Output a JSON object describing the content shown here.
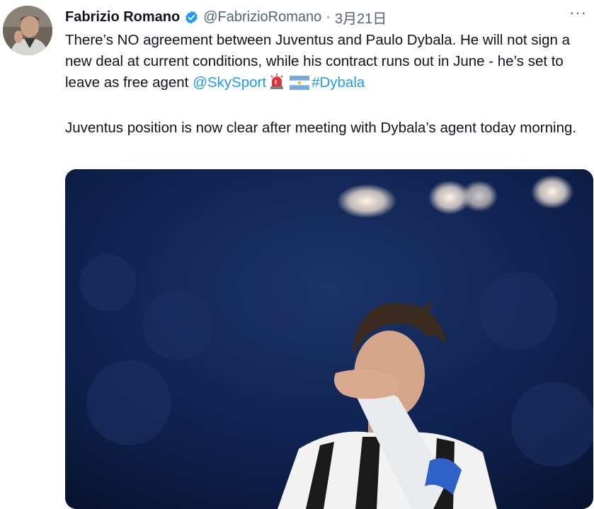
{
  "tweet": {
    "author_name": "Fabrizio Romano",
    "handle": "@FabrizioRomano",
    "separator": "·",
    "date": "3月21日",
    "more_label": "···",
    "verified_icon": "verified-badge-icon",
    "text_line1_before": "There’s NO agreement between Juventus and Paulo Dybala. He will not sign a new deal at current conditions, while his contract runs out in June - he’s set to leave as free agent ",
    "mention": "@SkySport",
    "emojis": [
      "siren-icon",
      "argentina-flag-icon"
    ],
    "hashtag": "#Dybala",
    "paragraph2": "Juventus position is now clear after meeting with Dybala’s agent today morning."
  },
  "colors": {
    "link": "#1d9bf0",
    "secondary_text": "#536471",
    "primary_text": "#0f1419"
  }
}
